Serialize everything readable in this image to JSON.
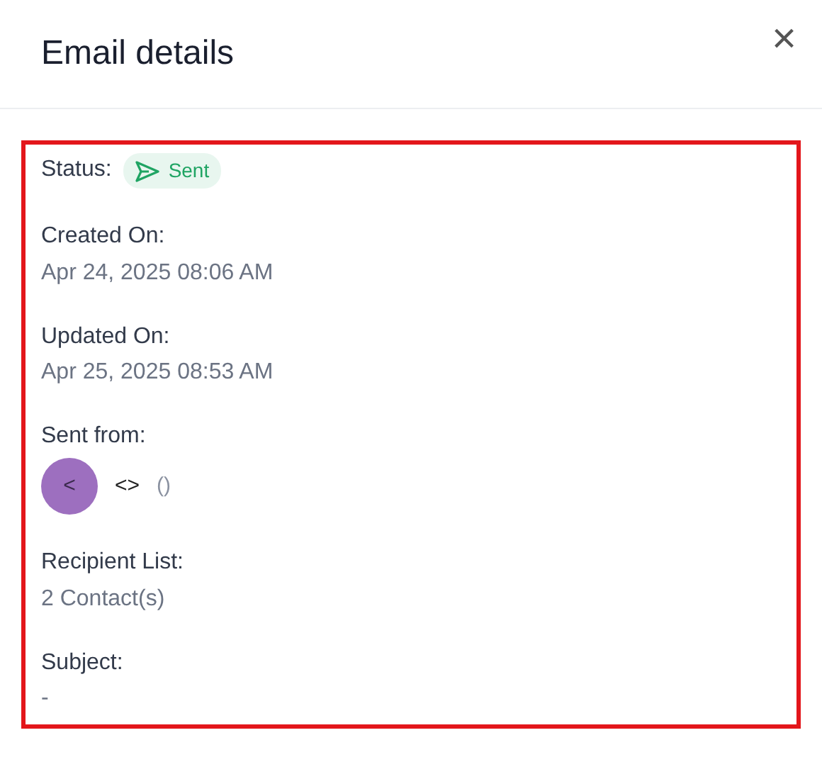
{
  "header": {
    "title": "Email details",
    "close": "×"
  },
  "highlighted": true,
  "status": {
    "label": "Status:",
    "value": "Sent",
    "color": "#1fa463"
  },
  "fields": [
    {
      "kind": "text",
      "label": "Created On:",
      "value": "Apr 24, 2025 08:06 AM"
    },
    {
      "kind": "text",
      "label": "Updated On:",
      "value": "Apr 25, 2025 08:53 AM"
    },
    {
      "kind": "sender",
      "label": "Sent from:",
      "avatar": "<",
      "name": "<>",
      "email": "()"
    },
    {
      "kind": "text",
      "label": "Recipient List:",
      "value": "2 Contact(s)"
    },
    {
      "kind": "text",
      "label": "Subject:",
      "value": "-"
    }
  ]
}
